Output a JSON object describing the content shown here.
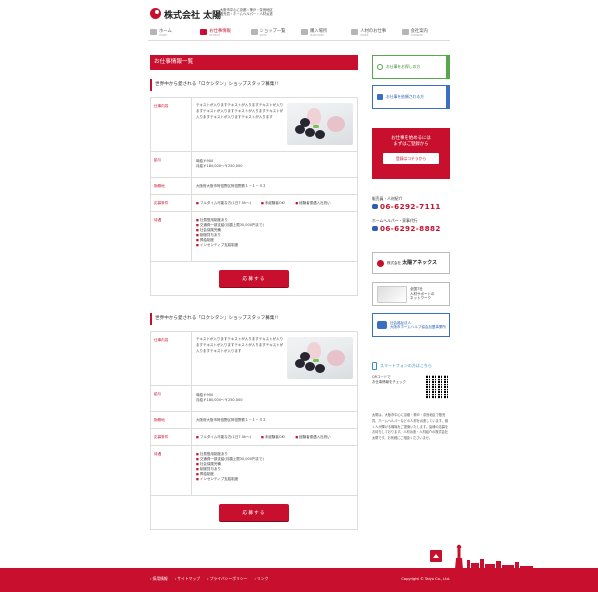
{
  "header": {
    "logo_text": "株式会社 太陽",
    "tagline": [
      "大阪市中心に京都・神戸・奈良地区",
      "販売員・ホームヘルパー・人材派遣",
      "株式会社太陽"
    ]
  },
  "gnav": [
    {
      "jp": "ホーム",
      "en": "HOME",
      "icon": "home-icon"
    },
    {
      "jp": "お仕事情報",
      "en": "RECRUIT",
      "icon": "briefcase-icon",
      "active": true
    },
    {
      "jp": "ショップ一覧",
      "en": "SHOP",
      "icon": "shop-icon"
    },
    {
      "jp": "購入場所",
      "en": "PURCHASE",
      "icon": "people-icon"
    },
    {
      "jp": "人材のお仕事",
      "en": "WORK",
      "icon": "car-icon"
    },
    {
      "jp": "会社案内",
      "en": "COMPANY",
      "icon": "building-icon"
    }
  ],
  "main": {
    "page_title": "お仕事情報一覧",
    "jobs": [
      {
        "title": "世界中から愛される「ロクシタン」ショップスタッフ募集!!",
        "desc_label": "仕事内容",
        "desc": "テキストが入りますテキストが入りますテキストが入りますテキストが入りますテキストが入りますテキストが入りますテキストが入りますテキストが入ります",
        "pay_label": "給与",
        "pay_line1": "時給￥900",
        "pay_line2": "月給￥180,000〜￥250,000",
        "place_label": "勤務地",
        "place": "大阪府大阪市阿倍野区阿倍野筋１－１－４２",
        "cond_label": "応募条件",
        "conds": [
          "フルタイム可能な方(1日7.5h〜)",
          "未経験者OK!",
          "経験者優遇入社祝い"
        ],
        "bene_label": "待遇",
        "benes": [
          "社員登用制度あり",
          "交通費一部支給(月額上限30,000円まで)",
          "社会保険完備",
          "制服貸与あり",
          "昇給制度",
          "インセンティブ支給制度"
        ],
        "apply_label": "応募する"
      },
      {
        "title": "世界中から愛される「ロクシタン」ショップスタッフ募集!!",
        "desc_label": "仕事内容",
        "desc": "テキストが入りますテキストが入りますテキストが入りますテキストが入りますテキストが入りますテキストが入りますテキストが入ります",
        "pay_label": "給与",
        "pay_line1": "時給￥900",
        "pay_line2": "月給￥180,000〜￥250,000",
        "place_label": "勤務地",
        "place": "大阪府大阪市阿倍野区阿倍野筋１－１－４２",
        "cond_label": "応募条件",
        "conds": [
          "フルタイム可能な方(1日7.5h〜)",
          "未経験者OK!",
          "経験者優遇入社祝い"
        ],
        "bene_label": "待遇",
        "benes": [
          "社員登用制度あり",
          "交通費一部支給(月額上限30,000円まで)",
          "社会保険完備",
          "制服貸与あり",
          "昇給制度",
          "インセンティブ支給制度"
        ],
        "apply_label": "応募する"
      }
    ]
  },
  "side": {
    "btn_search": "お仕事をお探しの方",
    "btn_client": "お仕事を依頼される方",
    "red_line1": "お仕事を始めるには",
    "red_line2": "まずはご登録から",
    "red_btn": "登録はコチラから",
    "sales_label": "販売員・人材紹介",
    "sales_tel": "06-6292-7111",
    "helper_label": "ホームヘルパー・家事代行",
    "helper_tel": "06-6292-8882",
    "annex_small": "株式会社",
    "annex": "太陽アネックス",
    "trycome_1": "全国7社",
    "trycome_2": "人材サポートの",
    "trycome_3": "ネットワーク",
    "loop_1": "社会福祉法人",
    "loop_2": "大阪市ホームヘルプ協会加盟事業所",
    "sp_head": "スマートフォンの方はこちら",
    "sp_1": "QRコードで",
    "sp_2": "お仕事情報をチェック",
    "about": "太陽は、大阪市中心に京都・神戸・奈良地区で販売員、ホームヘルパーなどの人材を派遣しています。働く人が輝ける職場をご提案いたします。皆様の応募をお待ちしております。人材派遣・人材紹介の株式会社太陽です。お気軽にご相談くださいませ。"
  },
  "footer": {
    "links": [
      "採用情報",
      "サイトマップ",
      "プライバシーポリシー",
      "リンク"
    ],
    "copyright": "Copyright © Taiyo Co., Ltd."
  },
  "colors": {
    "accent": "#c8102e",
    "green": "#57a84b",
    "blue": "#3b6fc1"
  }
}
